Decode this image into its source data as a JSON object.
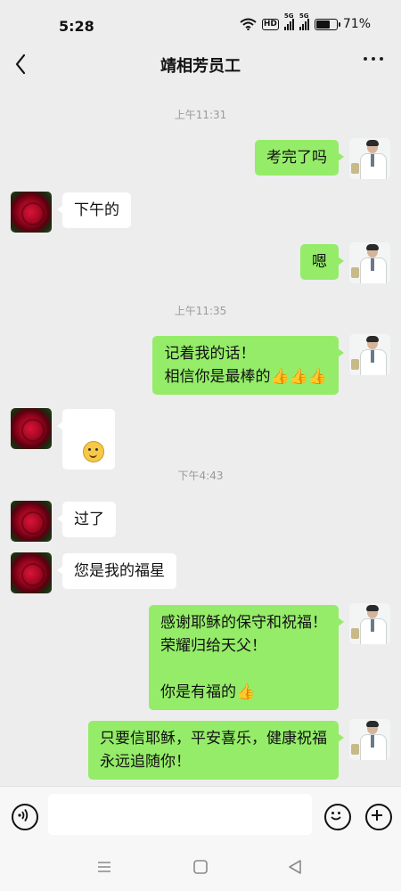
{
  "status_bar": {
    "time": "5:28",
    "network_badge_hd": "HD",
    "signal_label_1": "5G",
    "signal_label_2": "5G",
    "battery": "71%"
  },
  "header": {
    "title": "靖相芳员工"
  },
  "chat": {
    "timestamps": [
      "上午11:31",
      "上午11:35",
      "下午4:43"
    ],
    "messages": [
      {
        "from": "me",
        "text": "考完了吗"
      },
      {
        "from": "them",
        "text": "下午的"
      },
      {
        "from": "me",
        "text": "嗯"
      },
      {
        "from": "me",
        "text": "记着我的话！\n相信你是最棒的👍👍👍"
      },
      {
        "from": "them",
        "text": "",
        "emoji": "smile"
      },
      {
        "from": "them",
        "text": "过了"
      },
      {
        "from": "them",
        "text": "您是我的福星"
      },
      {
        "from": "me",
        "text": "感谢耶稣的保守和祝福！\n荣耀归给天父！\n\n你是有福的👍"
      },
      {
        "from": "me",
        "text": "只要信耶稣，平安喜乐，健康祝福\n永远追随你！"
      }
    ]
  },
  "input_bar": {
    "text_value": ""
  },
  "colors": {
    "my_bubble": "#95ec69",
    "their_bubble": "#ffffff",
    "background": "#ededed"
  },
  "icons": [
    "back-arrow-icon",
    "more-dots-icon",
    "voice-icon",
    "emoji-icon",
    "plus-icon",
    "menu-nav-icon",
    "home-nav-icon",
    "back-nav-icon"
  ]
}
